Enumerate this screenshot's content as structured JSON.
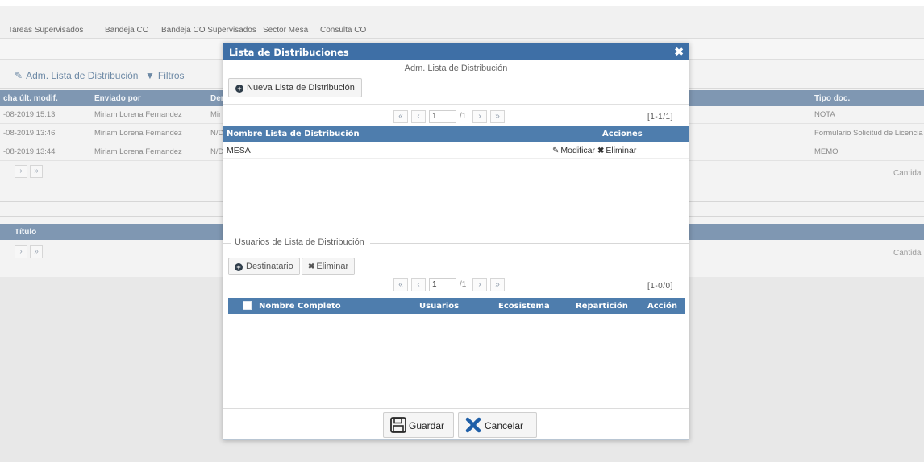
{
  "nav": {
    "tabs": [
      "Tareas Supervisados",
      "Bandeja CO",
      "Bandeja CO Supervisados",
      "Sector Mesa",
      "Consulta CO"
    ]
  },
  "toolbar": {
    "adm_label": "Adm. Lista de Distribución",
    "filtros_label": "Filtros"
  },
  "background_table": {
    "headers": [
      "cha últ. modif.",
      "Enviado por",
      "Der",
      "Tipo doc."
    ],
    "rows": [
      {
        "fecha": "-08-2019 15:13",
        "enviado": "Miriam Lorena Fernandez",
        "der": "Mir",
        "tipo": "NOTA"
      },
      {
        "fecha": "-08-2019 13:46",
        "enviado": "Miriam Lorena Fernandez",
        "der": "N/D",
        "tipo": "Formulario Solicitud de Licencia"
      },
      {
        "fecha": "-08-2019 13:44",
        "enviado": "Miriam Lorena Fernandez",
        "der": "N/D",
        "tipo": "MEMO"
      }
    ],
    "cantidad_label": "Cantida",
    "title_header": "Título",
    "cantidad_label_2": "Cantida"
  },
  "modal": {
    "title": "Lista de Distribuciones",
    "subtitle": "Adm. Lista de Distribución",
    "nueva_button": "Nueva Lista de Distribución",
    "pager1": {
      "page": "1",
      "total": "/1",
      "count": "[1-1/1]"
    },
    "list_table": {
      "col_nombre": "Nombre Lista de Distribución",
      "col_acciones": "Acciones",
      "rows": [
        {
          "nombre": "MESA",
          "modificar": "Modificar",
          "eliminar": "Eliminar"
        }
      ]
    },
    "usuarios_legend": "Usuarios de Lista de Distribución",
    "destinatario_button": "Destinatario",
    "eliminar_button": "Eliminar",
    "pager2": {
      "page": "1",
      "total": "/1",
      "count": "[1-0/0]"
    },
    "users_table": {
      "col_nombre": "Nombre Completo",
      "col_usuarios": "Usuarios",
      "col_ecosistema": "Ecosistema",
      "col_reparticion": "Repartición",
      "col_accion": "Acción"
    },
    "guardar_button": "Guardar",
    "cancelar_button": "Cancelar"
  },
  "colors": {
    "modal_header": "#3e6fa6",
    "table_header": "#4e7dad",
    "bg_table_header": "#7f97b2",
    "cancel_icon": "#1f5fa8"
  },
  "icons": {
    "close": "close-icon",
    "plus": "plus-circle-icon",
    "pencil": "pencil-icon",
    "x": "x-icon",
    "save": "floppy-disk-icon",
    "cancel": "x-cancel-icon",
    "filter": "filter-icon",
    "edit": "edit-icon"
  }
}
